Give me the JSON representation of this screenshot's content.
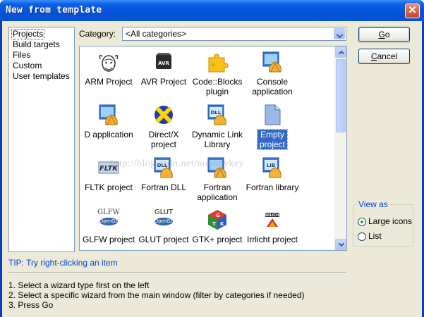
{
  "window": {
    "title": "New from template",
    "close_glyph": "✕"
  },
  "sidebar": {
    "items": [
      {
        "label": "Projects",
        "selected": true
      },
      {
        "label": "Build targets"
      },
      {
        "label": "Files"
      },
      {
        "label": "Custom"
      },
      {
        "label": "User templates"
      }
    ]
  },
  "category": {
    "label": "Category:",
    "value": "<All categories>"
  },
  "templates": [
    {
      "label": "ARM Project",
      "icon": "gnu-icon"
    },
    {
      "label": "AVR Project",
      "icon": "avr-chip-icon"
    },
    {
      "label": "Code::Blocks plugin",
      "icon": "puzzle-icon"
    },
    {
      "label": "Console application",
      "icon": "console-app-icon"
    },
    {
      "label": "D application",
      "icon": "d-app-icon"
    },
    {
      "label": "Direct/X project",
      "icon": "directx-icon"
    },
    {
      "label": "Dynamic Link Library",
      "icon": "dll-icon"
    },
    {
      "label": "Empty project",
      "icon": "blank-file-icon",
      "selected": true
    },
    {
      "label": "FLTK project",
      "icon": "fltk-icon"
    },
    {
      "label": "Fortran DLL",
      "icon": "fortran-dll-icon"
    },
    {
      "label": "Fortran application",
      "icon": "fortran-app-icon"
    },
    {
      "label": "Fortran library",
      "icon": "fortran-lib-icon"
    },
    {
      "label": "GLFW project",
      "icon": "glfw-icon",
      "logo_text": "GLFW"
    },
    {
      "label": "GLUT project",
      "icon": "glut-icon",
      "logo_text": "GLUT"
    },
    {
      "label": "GTK+ project",
      "icon": "gtk-icon"
    },
    {
      "label": "Irrlicht project",
      "icon": "irrlicht-icon"
    }
  ],
  "buttons": {
    "go_u": "G",
    "go_rest": "o",
    "cancel_u": "C",
    "cancel_rest": "ancel"
  },
  "view_as": {
    "title": "View as",
    "options": [
      {
        "label": "Large icons",
        "checked": true
      },
      {
        "label": "List",
        "checked": false
      }
    ]
  },
  "tip": "TIP: Try right-clicking an item",
  "instructions": [
    "1. Select a wizard type first on the left",
    "2. Select a specific wizard from the main window (filter by categories if needed)",
    "3. Press Go"
  ],
  "watermark": "http://blog.csdn.net/nobodykey"
}
